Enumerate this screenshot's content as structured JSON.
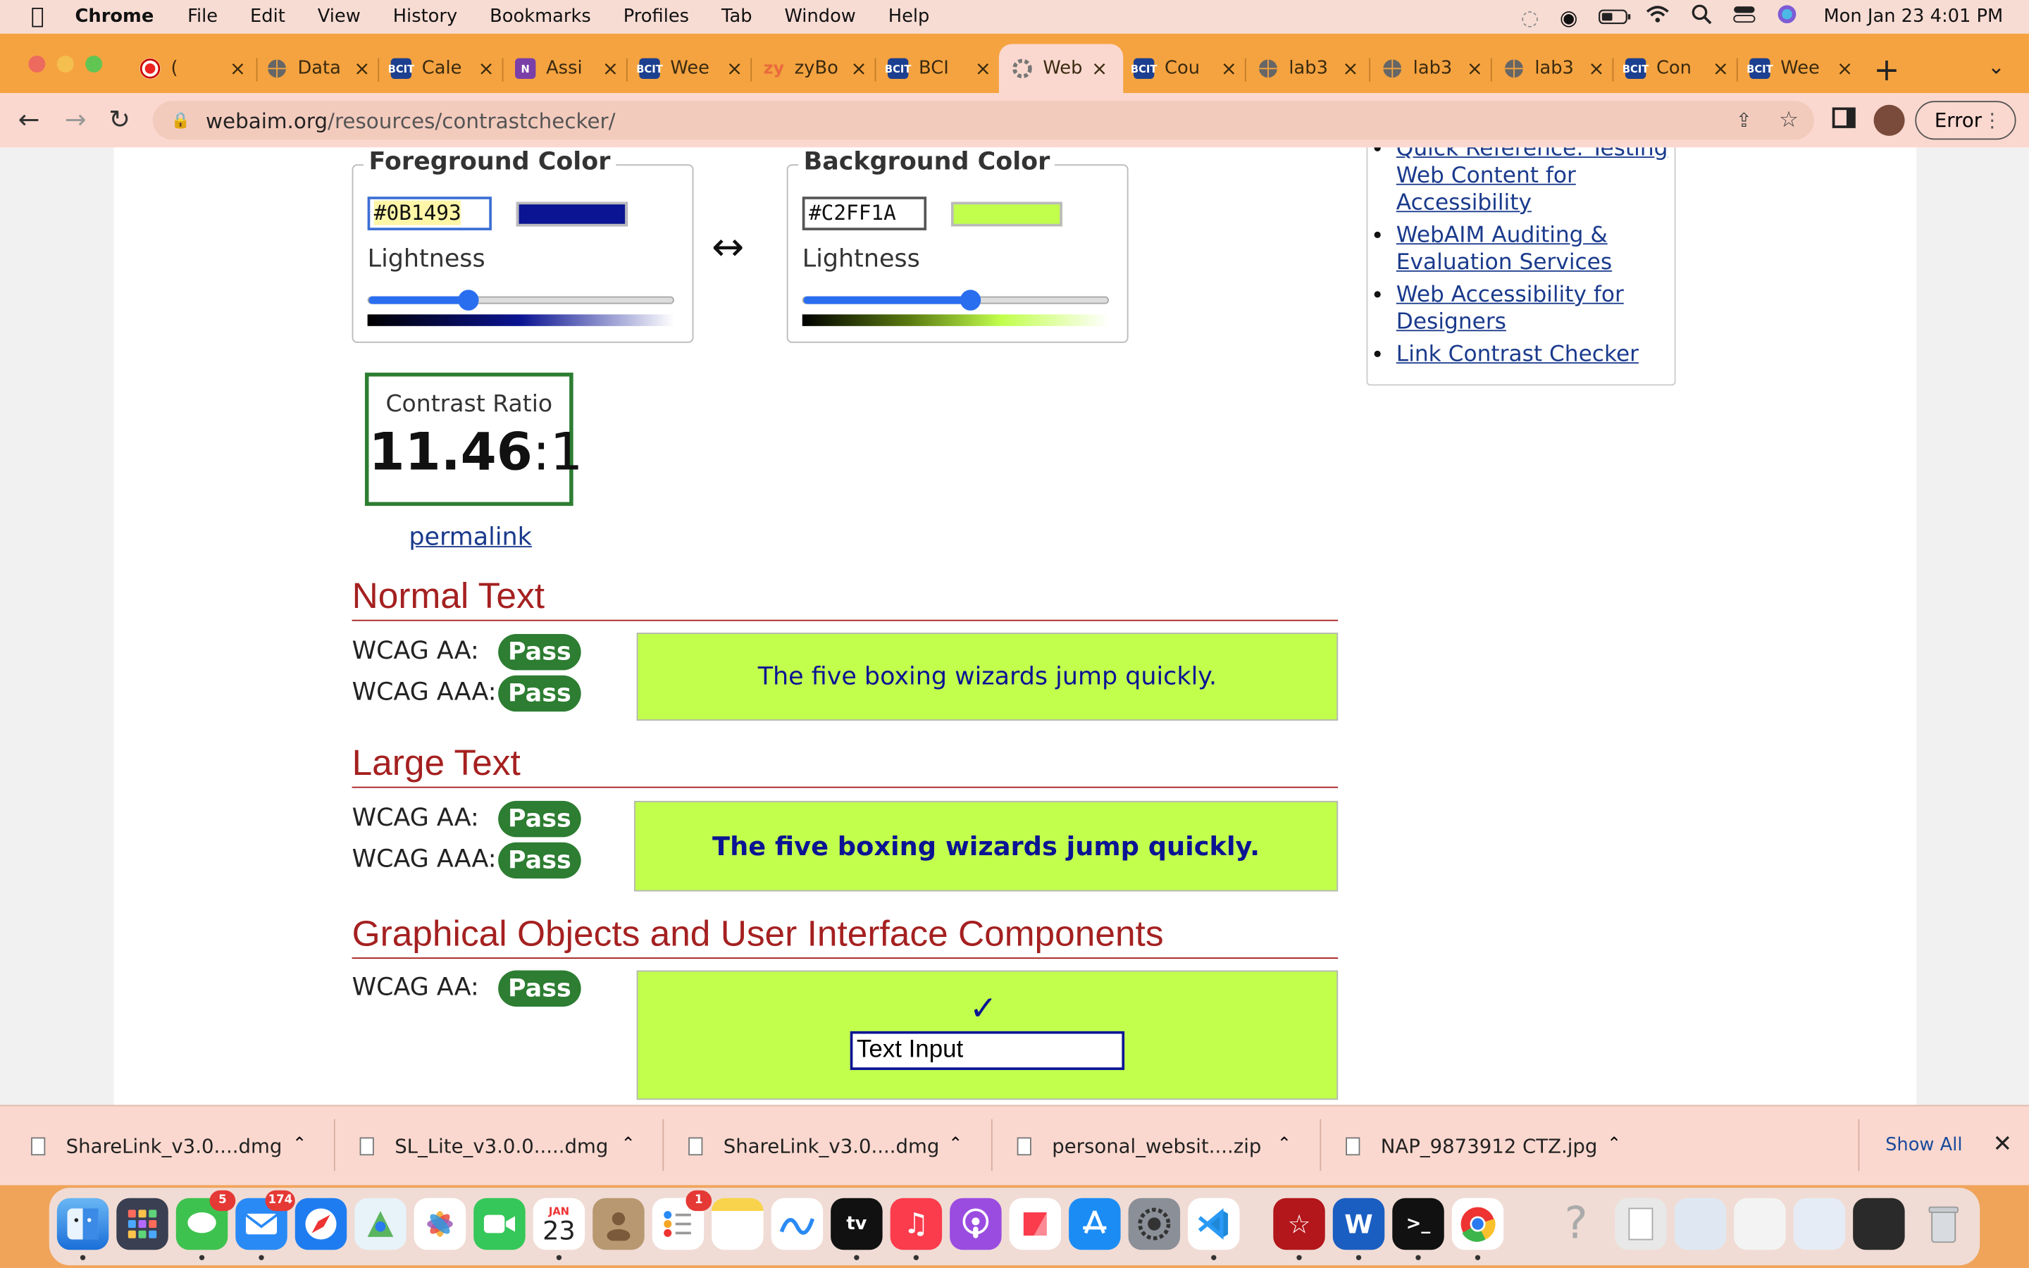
{
  "menubar": {
    "app": "Chrome",
    "items": [
      "File",
      "Edit",
      "View",
      "History",
      "Bookmarks",
      "Profiles",
      "Tab",
      "Window",
      "Help"
    ],
    "datetime": "Mon Jan 23  4:01 PM"
  },
  "tabs": [
    {
      "label": "(",
      "icon": "record-icon"
    },
    {
      "label": "Data",
      "icon": "globe-icon"
    },
    {
      "label": "Cale",
      "icon": "bcit-icon"
    },
    {
      "label": "Assi",
      "icon": "onenote-icon"
    },
    {
      "label": "Wee",
      "icon": "bcit-icon"
    },
    {
      "label": "zyBo",
      "icon": "zybooks-icon"
    },
    {
      "label": "BCI",
      "icon": "bcit-icon"
    },
    {
      "label": "Web",
      "icon": "webaim-icon",
      "active": true
    },
    {
      "label": "Cou",
      "icon": "bcit-icon"
    },
    {
      "label": "lab3",
      "icon": "globe-icon"
    },
    {
      "label": "lab3",
      "icon": "globe-icon"
    },
    {
      "label": "lab3",
      "icon": "globe-icon"
    },
    {
      "label": "Con",
      "icon": "bcit-icon"
    },
    {
      "label": "Wee",
      "icon": "bcit-icon"
    }
  ],
  "address": {
    "domain": "webaim.org",
    "path": "/resources/contrastchecker/"
  },
  "profile_button": "Error",
  "foreground": {
    "legend": "Foreground Color",
    "hex": "#0B1493",
    "color": "#0b1493",
    "lightness_label": "Lightness",
    "lightness_value": 0.33
  },
  "background": {
    "legend": "Background Color",
    "hex": "#C2FF1A",
    "color": "#c2ff4d",
    "lightness_label": "Lightness",
    "lightness_value": 0.55
  },
  "contrast": {
    "title": "Contrast Ratio",
    "ratio": "11.46",
    "suffix": ":1",
    "permalink": "permalink"
  },
  "normal_text": {
    "heading": "Normal Text",
    "aa_label": "WCAG AA:",
    "aa_result": "Pass",
    "aaa_label": "WCAG AAA:",
    "aaa_result": "Pass",
    "sample": "The five boxing wizards jump quickly."
  },
  "large_text": {
    "heading": "Large Text",
    "aa_label": "WCAG AA:",
    "aa_result": "Pass",
    "aaa_label": "WCAG AAA:",
    "aaa_result": "Pass",
    "sample": "The five boxing wizards jump quickly."
  },
  "graphical": {
    "heading": "Graphical Objects and User Interface Components",
    "aa_label": "WCAG AA:",
    "aa_result": "Pass",
    "checkmark": "✓",
    "input_text": "Text Input"
  },
  "sidebar_links": [
    "Quick Reference: Testing Web Content for Accessibility",
    "WebAIM Auditing & Evaluation Services",
    "Web Accessibility for Designers",
    "Link Contrast Checker"
  ],
  "downloads": [
    "ShareLink_v3.0....dmg",
    "SL_Lite_v3.0.0.....dmg",
    "ShareLink_v3.0....dmg",
    "personal_websit....zip",
    "NAP_9873912 CTZ.jpg"
  ],
  "downloads_show_all": "Show All",
  "dock": {
    "messages_badge": "5",
    "mail_badge": "174",
    "calendar_month": "JAN",
    "calendar_day": "23",
    "reminders_badge": "1",
    "appletv_label": "tv"
  },
  "colors": {
    "pass_green": "#2d7d32",
    "heading_red": "#a52020",
    "link_blue": "#1a3a8c",
    "tabstrip": "#f5a340"
  }
}
